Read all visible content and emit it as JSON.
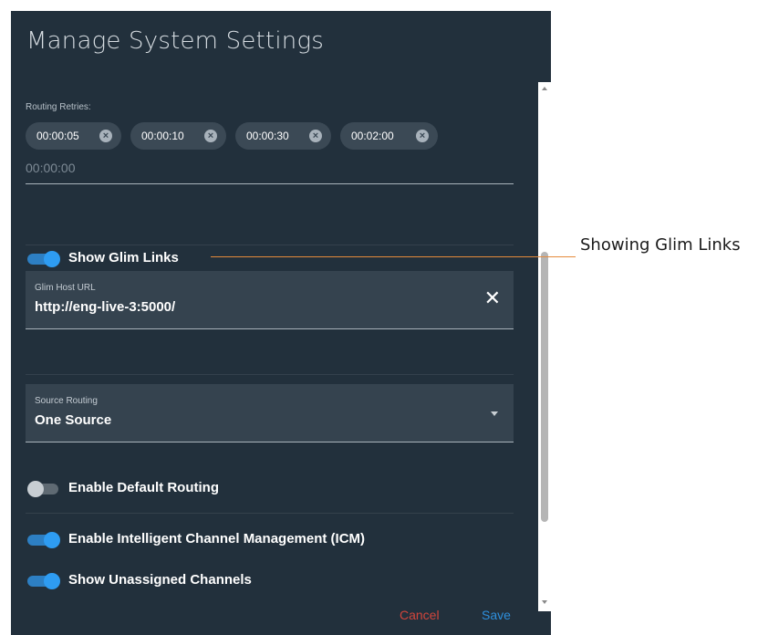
{
  "dialog": {
    "title": "Manage System Settings",
    "routing_retries": {
      "label": "Routing Retries:",
      "chips": [
        "00:00:05",
        "00:00:10",
        "00:00:30",
        "00:02:00"
      ],
      "input_placeholder": "00:00:00"
    },
    "show_glim_links": {
      "label": "Show Glim Links",
      "enabled": true
    },
    "glim_host_url": {
      "label": "Glim Host URL",
      "value": "http://eng-live-3:5000/",
      "clear_icon": "close-icon"
    },
    "source_routing": {
      "label": "Source Routing",
      "value": "One Source"
    },
    "enable_default_routing": {
      "label": "Enable Default Routing",
      "enabled": false
    },
    "enable_icm": {
      "label": "Enable Intelligent Channel Management (ICM)",
      "enabled": true
    },
    "show_unassigned_channels": {
      "label": "Show Unassigned Channels",
      "enabled": true
    },
    "footer": {
      "cancel_label": "Cancel",
      "save_label": "Save"
    }
  },
  "colors": {
    "dialog_bg": "#22303c",
    "toggle_on": "#2e9cf2",
    "cancel": "#d1453b",
    "save": "#2e8fdc",
    "callout": "#e58a3b"
  },
  "annotation": {
    "text": "Showing Glim Links"
  }
}
